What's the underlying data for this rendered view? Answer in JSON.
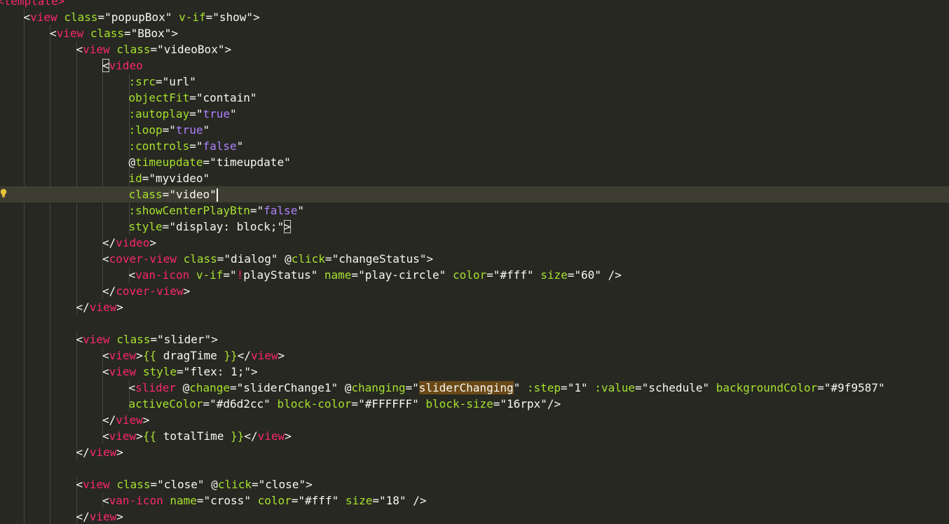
{
  "editor": {
    "theme_colors": {
      "background": "#272822",
      "current_line": "#3e3d32",
      "tag": "#f92672",
      "attribute": "#a6e22e",
      "string": "#f8f8f2",
      "keyword_value": "#ae81ff",
      "text": "#f8f8f2",
      "selection_highlight": "#6b4a18"
    },
    "gutter_icon": "lightbulb-icon",
    "current_line_index": 12,
    "lines": [
      {
        "indent": 0,
        "tokens": [
          {
            "t": "tag",
            "v": "<template>"
          }
        ]
      },
      {
        "indent": 1,
        "tokens": [
          {
            "t": "punct",
            "v": "<"
          },
          {
            "t": "tag",
            "v": "view"
          },
          {
            "t": "punct",
            "v": " "
          },
          {
            "t": "attr",
            "v": "class"
          },
          {
            "t": "punct",
            "v": "="
          },
          {
            "t": "str",
            "v": "\"popupBox\""
          },
          {
            "t": "punct",
            "v": " "
          },
          {
            "t": "attr",
            "v": "v-if"
          },
          {
            "t": "punct",
            "v": "="
          },
          {
            "t": "str",
            "v": "\"show\""
          },
          {
            "t": "punct",
            "v": ">"
          }
        ]
      },
      {
        "indent": 2,
        "tokens": [
          {
            "t": "punct",
            "v": "<"
          },
          {
            "t": "tag",
            "v": "view"
          },
          {
            "t": "punct",
            "v": " "
          },
          {
            "t": "attr",
            "v": "class"
          },
          {
            "t": "punct",
            "v": "="
          },
          {
            "t": "str",
            "v": "\"BBox\""
          },
          {
            "t": "punct",
            "v": ">"
          }
        ]
      },
      {
        "indent": 3,
        "tokens": [
          {
            "t": "punct",
            "v": "<"
          },
          {
            "t": "tag",
            "v": "view"
          },
          {
            "t": "punct",
            "v": " "
          },
          {
            "t": "attr",
            "v": "class"
          },
          {
            "t": "punct",
            "v": "="
          },
          {
            "t": "str",
            "v": "\"videoBox\""
          },
          {
            "t": "punct",
            "v": ">"
          }
        ]
      },
      {
        "indent": 4,
        "tokens": [
          {
            "t": "punct",
            "v": "<",
            "box": true
          },
          {
            "t": "tag",
            "v": "video"
          }
        ]
      },
      {
        "indent": 5,
        "tokens": [
          {
            "t": "attr",
            "v": ":src"
          },
          {
            "t": "punct",
            "v": "="
          },
          {
            "t": "str",
            "v": "\"url\""
          }
        ]
      },
      {
        "indent": 5,
        "tokens": [
          {
            "t": "attr",
            "v": "objectFit"
          },
          {
            "t": "punct",
            "v": "="
          },
          {
            "t": "str",
            "v": "\"contain\""
          }
        ]
      },
      {
        "indent": 5,
        "tokens": [
          {
            "t": "attr",
            "v": ":autoplay"
          },
          {
            "t": "punct",
            "v": "=\""
          },
          {
            "t": "kw",
            "v": "true"
          },
          {
            "t": "punct",
            "v": "\""
          }
        ]
      },
      {
        "indent": 5,
        "tokens": [
          {
            "t": "attr",
            "v": ":loop"
          },
          {
            "t": "punct",
            "v": "=\""
          },
          {
            "t": "kw",
            "v": "true"
          },
          {
            "t": "punct",
            "v": "\""
          }
        ]
      },
      {
        "indent": 5,
        "tokens": [
          {
            "t": "attr",
            "v": ":controls"
          },
          {
            "t": "punct",
            "v": "=\""
          },
          {
            "t": "kw",
            "v": "false"
          },
          {
            "t": "punct",
            "v": "\""
          }
        ]
      },
      {
        "indent": 5,
        "tokens": [
          {
            "t": "punct",
            "v": "@"
          },
          {
            "t": "attr",
            "v": "timeupdate"
          },
          {
            "t": "punct",
            "v": "="
          },
          {
            "t": "str",
            "v": "\"timeupdate\""
          }
        ]
      },
      {
        "indent": 5,
        "tokens": [
          {
            "t": "attr",
            "v": "id"
          },
          {
            "t": "punct",
            "v": "="
          },
          {
            "t": "str",
            "v": "\"myvideo\""
          }
        ]
      },
      {
        "indent": 5,
        "tokens": [
          {
            "t": "attr",
            "v": "class"
          },
          {
            "t": "punct",
            "v": "="
          },
          {
            "t": "str",
            "v": "\"video\""
          },
          {
            "t": "cursor",
            "v": ""
          }
        ]
      },
      {
        "indent": 5,
        "tokens": [
          {
            "t": "attr",
            "v": ":showCenterPlayBtn"
          },
          {
            "t": "punct",
            "v": "=\""
          },
          {
            "t": "kw",
            "v": "false"
          },
          {
            "t": "punct",
            "v": "\""
          }
        ]
      },
      {
        "indent": 5,
        "tokens": [
          {
            "t": "attr",
            "v": "style"
          },
          {
            "t": "punct",
            "v": "="
          },
          {
            "t": "str",
            "v": "\"display: block;\""
          },
          {
            "t": "punct",
            "v": ">",
            "box": true
          }
        ]
      },
      {
        "indent": 4,
        "tokens": [
          {
            "t": "punct",
            "v": "</"
          },
          {
            "t": "tag",
            "v": "video"
          },
          {
            "t": "punct",
            "v": ">"
          }
        ]
      },
      {
        "indent": 4,
        "tokens": [
          {
            "t": "punct",
            "v": "<"
          },
          {
            "t": "tag",
            "v": "cover-view"
          },
          {
            "t": "punct",
            "v": " "
          },
          {
            "t": "attr",
            "v": "class"
          },
          {
            "t": "punct",
            "v": "="
          },
          {
            "t": "str",
            "v": "\"dialog\""
          },
          {
            "t": "punct",
            "v": " @"
          },
          {
            "t": "attr",
            "v": "click"
          },
          {
            "t": "punct",
            "v": "="
          },
          {
            "t": "str",
            "v": "\"changeStatus\""
          },
          {
            "t": "punct",
            "v": ">"
          }
        ]
      },
      {
        "indent": 5,
        "tokens": [
          {
            "t": "punct",
            "v": "<"
          },
          {
            "t": "tag",
            "v": "van-icon"
          },
          {
            "t": "punct",
            "v": " "
          },
          {
            "t": "attr",
            "v": "v-if"
          },
          {
            "t": "punct",
            "v": "=\""
          },
          {
            "t": "tag",
            "v": "!"
          },
          {
            "t": "punct",
            "v": "playStatus\""
          },
          {
            "t": "punct",
            "v": " "
          },
          {
            "t": "attr",
            "v": "name"
          },
          {
            "t": "punct",
            "v": "="
          },
          {
            "t": "str",
            "v": "\"play-circle\""
          },
          {
            "t": "punct",
            "v": " "
          },
          {
            "t": "attr",
            "v": "color"
          },
          {
            "t": "punct",
            "v": "="
          },
          {
            "t": "str",
            "v": "\"#fff\""
          },
          {
            "t": "punct",
            "v": " "
          },
          {
            "t": "attr",
            "v": "size"
          },
          {
            "t": "punct",
            "v": "="
          },
          {
            "t": "str",
            "v": "\"60\""
          },
          {
            "t": "punct",
            "v": " />"
          }
        ]
      },
      {
        "indent": 4,
        "tokens": [
          {
            "t": "punct",
            "v": "</"
          },
          {
            "t": "tag",
            "v": "cover-view"
          },
          {
            "t": "punct",
            "v": ">"
          }
        ]
      },
      {
        "indent": 3,
        "tokens": [
          {
            "t": "punct",
            "v": "</"
          },
          {
            "t": "tag",
            "v": "view"
          },
          {
            "t": "punct",
            "v": ">"
          }
        ]
      },
      {
        "indent": 0,
        "tokens": []
      },
      {
        "indent": 3,
        "tokens": [
          {
            "t": "punct",
            "v": "<"
          },
          {
            "t": "tag",
            "v": "view"
          },
          {
            "t": "punct",
            "v": " "
          },
          {
            "t": "attr",
            "v": "class"
          },
          {
            "t": "punct",
            "v": "="
          },
          {
            "t": "str",
            "v": "\"slider\""
          },
          {
            "t": "punct",
            "v": ">"
          }
        ]
      },
      {
        "indent": 4,
        "tokens": [
          {
            "t": "punct",
            "v": "<"
          },
          {
            "t": "tag",
            "v": "view"
          },
          {
            "t": "punct",
            "v": ">"
          },
          {
            "t": "attr",
            "v": "{{"
          },
          {
            "t": "punct",
            "v": " dragTime "
          },
          {
            "t": "attr",
            "v": "}}"
          },
          {
            "t": "punct",
            "v": "</"
          },
          {
            "t": "tag",
            "v": "view"
          },
          {
            "t": "punct",
            "v": ">"
          }
        ]
      },
      {
        "indent": 4,
        "tokens": [
          {
            "t": "punct",
            "v": "<"
          },
          {
            "t": "tag",
            "v": "view"
          },
          {
            "t": "punct",
            "v": " "
          },
          {
            "t": "attr",
            "v": "style"
          },
          {
            "t": "punct",
            "v": "="
          },
          {
            "t": "str",
            "v": "\"flex: 1;\""
          },
          {
            "t": "punct",
            "v": ">"
          }
        ]
      },
      {
        "indent": 5,
        "tokens": [
          {
            "t": "punct",
            "v": "<"
          },
          {
            "t": "tag",
            "v": "slider"
          },
          {
            "t": "punct",
            "v": " @"
          },
          {
            "t": "attr",
            "v": "change"
          },
          {
            "t": "punct",
            "v": "="
          },
          {
            "t": "str",
            "v": "\"sliderChange1\""
          },
          {
            "t": "punct",
            "v": " @"
          },
          {
            "t": "attr",
            "v": "changing"
          },
          {
            "t": "punct",
            "v": "=\""
          },
          {
            "t": "sel",
            "v": "sliderChanging"
          },
          {
            "t": "punct",
            "v": "\""
          },
          {
            "t": "punct",
            "v": " "
          },
          {
            "t": "attr",
            "v": ":step"
          },
          {
            "t": "punct",
            "v": "="
          },
          {
            "t": "str",
            "v": "\"1\""
          },
          {
            "t": "punct",
            "v": " "
          },
          {
            "t": "attr",
            "v": ":value"
          },
          {
            "t": "punct",
            "v": "="
          },
          {
            "t": "str",
            "v": "\"schedule\""
          },
          {
            "t": "punct",
            "v": " "
          },
          {
            "t": "attr",
            "v": "backgroundColor"
          },
          {
            "t": "punct",
            "v": "="
          },
          {
            "t": "str",
            "v": "\"#9f9587\""
          }
        ]
      },
      {
        "indent": 5,
        "tokens": [
          {
            "t": "attr",
            "v": "activeColor"
          },
          {
            "t": "punct",
            "v": "="
          },
          {
            "t": "str",
            "v": "\"#d6d2cc\""
          },
          {
            "t": "punct",
            "v": " "
          },
          {
            "t": "attr",
            "v": "block-color"
          },
          {
            "t": "punct",
            "v": "="
          },
          {
            "t": "str",
            "v": "\"#FFFFFF\""
          },
          {
            "t": "punct",
            "v": " "
          },
          {
            "t": "attr",
            "v": "block-size"
          },
          {
            "t": "punct",
            "v": "="
          },
          {
            "t": "str",
            "v": "\"16rpx\""
          },
          {
            "t": "punct",
            "v": "/>"
          }
        ]
      },
      {
        "indent": 4,
        "tokens": [
          {
            "t": "punct",
            "v": "</"
          },
          {
            "t": "tag",
            "v": "view"
          },
          {
            "t": "punct",
            "v": ">"
          }
        ]
      },
      {
        "indent": 4,
        "tokens": [
          {
            "t": "punct",
            "v": "<"
          },
          {
            "t": "tag",
            "v": "view"
          },
          {
            "t": "punct",
            "v": ">"
          },
          {
            "t": "attr",
            "v": "{{"
          },
          {
            "t": "punct",
            "v": " totalTime "
          },
          {
            "t": "attr",
            "v": "}}"
          },
          {
            "t": "punct",
            "v": "</"
          },
          {
            "t": "tag",
            "v": "view"
          },
          {
            "t": "punct",
            "v": ">"
          }
        ]
      },
      {
        "indent": 3,
        "tokens": [
          {
            "t": "punct",
            "v": "</"
          },
          {
            "t": "tag",
            "v": "view"
          },
          {
            "t": "punct",
            "v": ">"
          }
        ]
      },
      {
        "indent": 0,
        "tokens": []
      },
      {
        "indent": 3,
        "tokens": [
          {
            "t": "punct",
            "v": "<"
          },
          {
            "t": "tag",
            "v": "view"
          },
          {
            "t": "punct",
            "v": " "
          },
          {
            "t": "attr",
            "v": "class"
          },
          {
            "t": "punct",
            "v": "="
          },
          {
            "t": "str",
            "v": "\"close\""
          },
          {
            "t": "punct",
            "v": " @"
          },
          {
            "t": "attr",
            "v": "click"
          },
          {
            "t": "punct",
            "v": "="
          },
          {
            "t": "str",
            "v": "\"close\""
          },
          {
            "t": "punct",
            "v": ">"
          }
        ]
      },
      {
        "indent": 4,
        "tokens": [
          {
            "t": "punct",
            "v": "<"
          },
          {
            "t": "tag",
            "v": "van-icon"
          },
          {
            "t": "punct",
            "v": " "
          },
          {
            "t": "attr",
            "v": "name"
          },
          {
            "t": "punct",
            "v": "="
          },
          {
            "t": "str",
            "v": "\"cross\""
          },
          {
            "t": "punct",
            "v": " "
          },
          {
            "t": "attr",
            "v": "color"
          },
          {
            "t": "punct",
            "v": "="
          },
          {
            "t": "str",
            "v": "\"#fff\""
          },
          {
            "t": "punct",
            "v": " "
          },
          {
            "t": "attr",
            "v": "size"
          },
          {
            "t": "punct",
            "v": "="
          },
          {
            "t": "str",
            "v": "\"18\""
          },
          {
            "t": "punct",
            "v": " />"
          }
        ]
      },
      {
        "indent": 3,
        "tokens": [
          {
            "t": "punct",
            "v": "</"
          },
          {
            "t": "tag",
            "v": "view"
          },
          {
            "t": "punct",
            "v": ">"
          }
        ]
      }
    ]
  }
}
